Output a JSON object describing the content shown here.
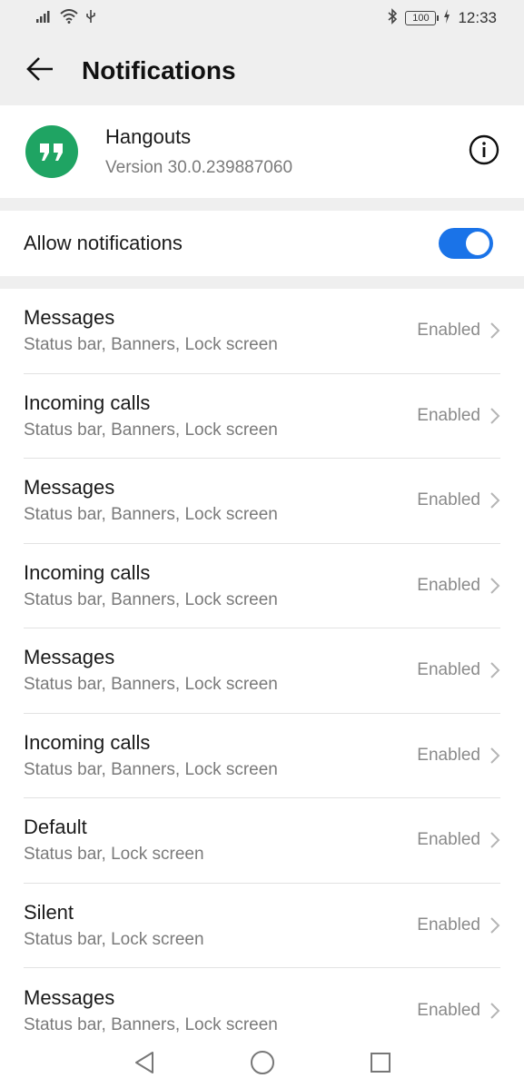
{
  "status_bar": {
    "time": "12:33",
    "battery": "100",
    "icons": [
      "signal-icon",
      "wifi-icon",
      "usb-icon",
      "bluetooth-icon",
      "battery-icon",
      "charging-icon"
    ]
  },
  "header": {
    "title": "Notifications",
    "back_icon": "back-arrow-icon"
  },
  "app": {
    "name": "Hangouts",
    "version": "Version 30.0.239887060",
    "icon": "hangouts-icon",
    "icon_color": "#1fa463"
  },
  "allow": {
    "label": "Allow notifications",
    "enabled": true,
    "toggle_color": "#1a73e8"
  },
  "channels": [
    {
      "title": "Messages",
      "subtitle": "Status bar, Banners, Lock screen",
      "status": "Enabled"
    },
    {
      "title": "Incoming calls",
      "subtitle": "Status bar, Banners, Lock screen",
      "status": "Enabled"
    },
    {
      "title": "Messages",
      "subtitle": "Status bar, Banners, Lock screen",
      "status": "Enabled"
    },
    {
      "title": "Incoming calls",
      "subtitle": "Status bar, Banners, Lock screen",
      "status": "Enabled"
    },
    {
      "title": "Messages",
      "subtitle": "Status bar, Banners, Lock screen",
      "status": "Enabled"
    },
    {
      "title": "Incoming calls",
      "subtitle": "Status bar, Banners, Lock screen",
      "status": "Enabled"
    },
    {
      "title": "Default",
      "subtitle": "Status bar, Lock screen",
      "status": "Enabled"
    },
    {
      "title": "Silent",
      "subtitle": "Status bar, Lock screen",
      "status": "Enabled"
    },
    {
      "title": "Messages",
      "subtitle": "Status bar, Banners, Lock screen",
      "status": "Enabled"
    }
  ],
  "nav": [
    "back-triangle-icon",
    "home-circle-icon",
    "recents-square-icon"
  ]
}
